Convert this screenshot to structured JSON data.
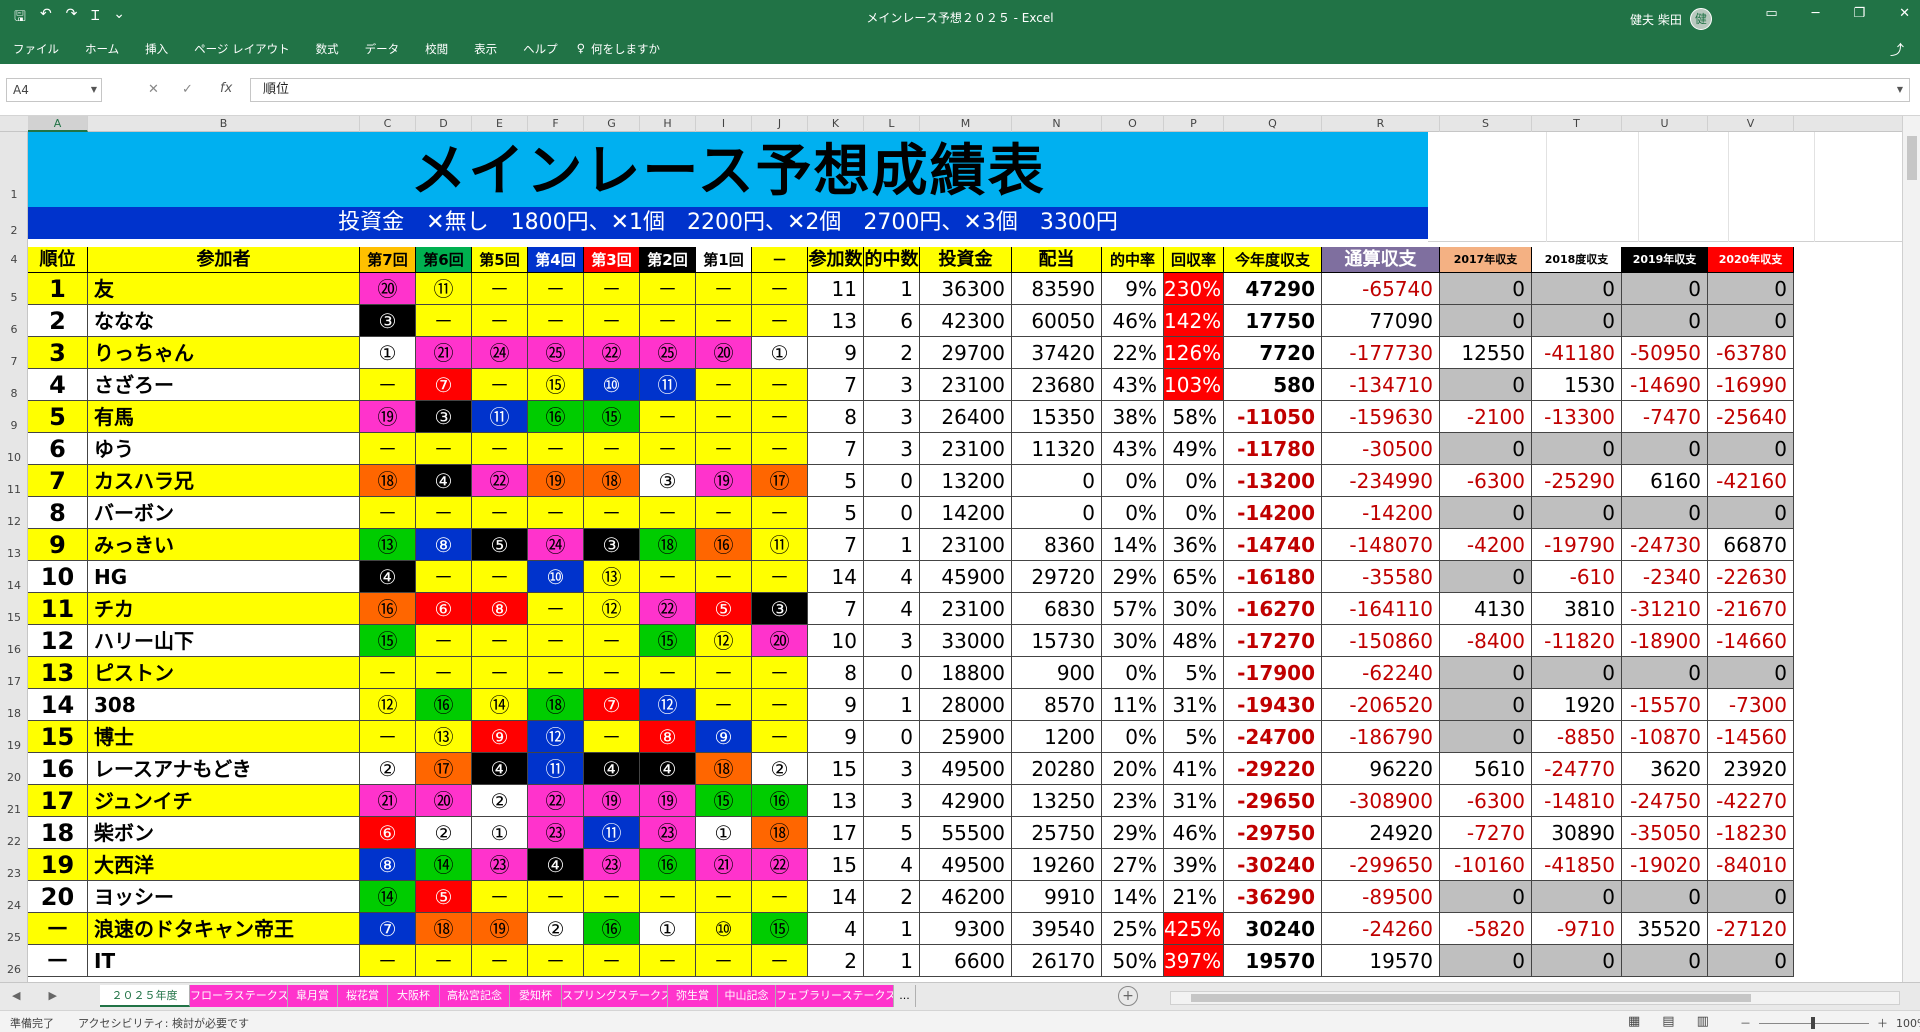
{
  "window": {
    "title": "メインレース予想２０２５ - Excel",
    "user": "健夫 柴田",
    "user_initial": "健"
  },
  "qat": {
    "save": "🖫",
    "undo": "↶",
    "redo": "↷",
    "custom": "Ɪ",
    "more": "⌄"
  },
  "ribbon": {
    "tabs": [
      "ファイル",
      "ホーム",
      "挿入",
      "ページ レイアウト",
      "数式",
      "データ",
      "校閲",
      "表示",
      "ヘルプ"
    ],
    "tell_me": "何をしますか",
    "tell_icon": "♀"
  },
  "formula": {
    "cell_ref": "A4",
    "value": "順位",
    "fx": "fx"
  },
  "columns": [
    "A",
    "B",
    "C",
    "D",
    "E",
    "F",
    "G",
    "H",
    "I",
    "J",
    "K",
    "L",
    "M",
    "N",
    "O",
    "P",
    "Q",
    "R",
    "S",
    "T",
    "U",
    "V"
  ],
  "row_numbers": [
    "1",
    "2",
    "4",
    "5",
    "6",
    "7",
    "8",
    "9",
    "10",
    "11",
    "12",
    "13",
    "14",
    "15",
    "16",
    "17",
    "18",
    "19",
    "20",
    "21",
    "22",
    "23",
    "24",
    "25",
    "26"
  ],
  "sheet": {
    "title": "メインレース予想成績表",
    "subtitle": "投資金　✕無し　1800円、✕1個　2200円、✕2個　2700円、✕3個　3300円",
    "headers": [
      "順位",
      "参加者",
      "第7回",
      "第6回",
      "第5回",
      "第4回",
      "第3回",
      "第2回",
      "第1回",
      "－",
      "参加数",
      "的中数",
      "投資金",
      "配当",
      "的中率",
      "回収率",
      "今年度収支",
      "通算収支",
      "2017年収支",
      "2018度収支",
      "2019年収支",
      "2020年収支"
    ],
    "rows": [
      [
        "1",
        "友",
        "⑳",
        "⑪",
        "－",
        "－",
        "－",
        "－",
        "－",
        "－",
        "11",
        "1",
        "36300",
        "83590",
        "9%",
        "230%",
        "47290",
        "-65740",
        "0",
        "0",
        "0",
        "0"
      ],
      [
        "2",
        "ななな",
        "③",
        "－",
        "－",
        "－",
        "－",
        "－",
        "－",
        "－",
        "13",
        "6",
        "42300",
        "60050",
        "46%",
        "142%",
        "17750",
        "77090",
        "0",
        "0",
        "0",
        "0"
      ],
      [
        "3",
        "りっちゃん",
        "①",
        "㉑",
        "㉔",
        "㉕",
        "㉒",
        "㉕",
        "⑳",
        "①",
        "9",
        "2",
        "29700",
        "37420",
        "22%",
        "126%",
        "7720",
        "-177730",
        "12550",
        "-41180",
        "-50950",
        "-63780"
      ],
      [
        "4",
        "さざろー",
        "－",
        "⑦",
        "－",
        "⑮",
        "⑩",
        "⑪",
        "－",
        "－",
        "7",
        "3",
        "23100",
        "23680",
        "43%",
        "103%",
        "580",
        "-134710",
        "0",
        "1530",
        "-14690",
        "-16990"
      ],
      [
        "5",
        "有馬",
        "⑲",
        "③",
        "⑪",
        "⑯",
        "⑮",
        "－",
        "－",
        "－",
        "8",
        "3",
        "26400",
        "15350",
        "38%",
        "58%",
        "-11050",
        "-159630",
        "-2100",
        "-13300",
        "-7470",
        "-25640"
      ],
      [
        "6",
        "ゆう",
        "－",
        "－",
        "－",
        "－",
        "－",
        "－",
        "－",
        "－",
        "7",
        "3",
        "23100",
        "11320",
        "43%",
        "49%",
        "-11780",
        "-30500",
        "0",
        "0",
        "0",
        "0"
      ],
      [
        "7",
        "カスハラ兄",
        "⑱",
        "④",
        "㉒",
        "⑲",
        "⑱",
        "③",
        "⑲",
        "⑰",
        "5",
        "0",
        "13200",
        "0",
        "0%",
        "0%",
        "-13200",
        "-234990",
        "-6300",
        "-25290",
        "6160",
        "-42160"
      ],
      [
        "8",
        "バーボン",
        "－",
        "－",
        "－",
        "－",
        "－",
        "－",
        "－",
        "－",
        "5",
        "0",
        "14200",
        "0",
        "0%",
        "0%",
        "-14200",
        "-14200",
        "0",
        "0",
        "0",
        "0"
      ],
      [
        "9",
        "みっきい",
        "⑬",
        "⑧",
        "⑤",
        "㉔",
        "③",
        "⑱",
        "⑯",
        "⑪",
        "7",
        "1",
        "23100",
        "8360",
        "14%",
        "36%",
        "-14740",
        "-148070",
        "-4200",
        "-19790",
        "-24730",
        "66870"
      ],
      [
        "10",
        "HG",
        "④",
        "－",
        "－",
        "⑩",
        "⑬",
        "－",
        "－",
        "－",
        "14",
        "4",
        "45900",
        "29720",
        "29%",
        "65%",
        "-16180",
        "-35580",
        "0",
        "-610",
        "-2340",
        "-22630"
      ],
      [
        "11",
        "チカ",
        "⑯",
        "⑥",
        "⑧",
        "－",
        "⑫",
        "㉒",
        "⑤",
        "③",
        "7",
        "4",
        "23100",
        "6830",
        "57%",
        "30%",
        "-16270",
        "-164110",
        "4130",
        "3810",
        "-31210",
        "-21670"
      ],
      [
        "12",
        "ハリー山下",
        "⑮",
        "－",
        "－",
        "－",
        "－",
        "⑮",
        "⑫",
        "⑳",
        "10",
        "3",
        "33000",
        "15730",
        "30%",
        "48%",
        "-17270",
        "-150860",
        "-8400",
        "-11820",
        "-18900",
        "-14660"
      ],
      [
        "13",
        "ピストン",
        "－",
        "－",
        "－",
        "－",
        "－",
        "－",
        "－",
        "－",
        "8",
        "0",
        "18800",
        "900",
        "0%",
        "5%",
        "-17900",
        "-62240",
        "0",
        "0",
        "0",
        "0"
      ],
      [
        "14",
        "308",
        "⑫",
        "⑯",
        "⑭",
        "⑱",
        "⑦",
        "⑫",
        "－",
        "－",
        "9",
        "1",
        "28000",
        "8570",
        "11%",
        "31%",
        "-19430",
        "-206520",
        "0",
        "1920",
        "-15570",
        "-7300"
      ],
      [
        "15",
        "博士",
        "－",
        "⑬",
        "⑨",
        "⑫",
        "－",
        "⑧",
        "⑨",
        "－",
        "9",
        "0",
        "25900",
        "1200",
        "0%",
        "5%",
        "-24700",
        "-186790",
        "0",
        "-8850",
        "-10870",
        "-14560"
      ],
      [
        "16",
        "レースアナもどき",
        "②",
        "⑰",
        "④",
        "⑪",
        "④",
        "④",
        "⑱",
        "②",
        "15",
        "3",
        "49500",
        "20280",
        "20%",
        "41%",
        "-29220",
        "96220",
        "5610",
        "-24770",
        "3620",
        "23920"
      ],
      [
        "17",
        "ジュンイチ",
        "㉑",
        "⑳",
        "②",
        "㉒",
        "⑲",
        "⑲",
        "⑮",
        "⑯",
        "13",
        "3",
        "42900",
        "13250",
        "23%",
        "31%",
        "-29650",
        "-308900",
        "-6300",
        "-14810",
        "-24750",
        "-42270"
      ],
      [
        "18",
        "柴ボン",
        "⑥",
        "②",
        "①",
        "㉓",
        "⑪",
        "㉓",
        "①",
        "⑱",
        "17",
        "5",
        "55500",
        "25750",
        "29%",
        "46%",
        "-29750",
        "24920",
        "-7270",
        "30890",
        "-35050",
        "-18230"
      ],
      [
        "19",
        "大西洋",
        "⑧",
        "⑭",
        "㉓",
        "④",
        "㉓",
        "⑯",
        "㉑",
        "㉒",
        "15",
        "4",
        "49500",
        "19260",
        "27%",
        "39%",
        "-30240",
        "-299650",
        "-10160",
        "-41850",
        "-19020",
        "-84010"
      ],
      [
        "20",
        "ヨッシー",
        "⑭",
        "⑤",
        "－",
        "－",
        "－",
        "－",
        "－",
        "－",
        "14",
        "2",
        "46200",
        "9910",
        "14%",
        "21%",
        "-36290",
        "-89500",
        "0",
        "0",
        "0",
        "0"
      ],
      [
        "－",
        "浪速のドタキャン帝王",
        "⑦",
        "⑱",
        "⑲",
        "②",
        "⑯",
        "①",
        "⑩",
        "⑮",
        "4",
        "1",
        "9300",
        "39540",
        "25%",
        "425%",
        "30240",
        "-24260",
        "-5820",
        "-9710",
        "35520",
        "-27120"
      ],
      [
        "－",
        "IT",
        "－",
        "－",
        "－",
        "－",
        "－",
        "－",
        "－",
        "－",
        "2",
        "1",
        "6600",
        "26170",
        "50%",
        "397%",
        "19570",
        "19570",
        "0",
        "0",
        "0",
        "0"
      ]
    ]
  },
  "sheet_tabs": [
    "２０２５年度",
    "フローラステークス",
    "皐月賞",
    "桜花賞",
    "大阪杯",
    "高松宮記念",
    "愛知杯",
    "スプリングステークス",
    "弥生賞",
    "中山記念",
    "フェブラリーステークス",
    "..."
  ],
  "status": {
    "ready": "準備完了",
    "accessibility": "アクセシビリティ: 検討が必要です",
    "zoom": "100%",
    "zoom_minus": "－",
    "zoom_plus": "＋"
  },
  "colors": {
    "title_bar": "#217346",
    "banner": "#00b0f0",
    "subtitle_bar": "#0033cc",
    "header_yellow": "#ffff00",
    "negative": "#c00000",
    "sheet_tab_pink": "#ff33cc"
  }
}
